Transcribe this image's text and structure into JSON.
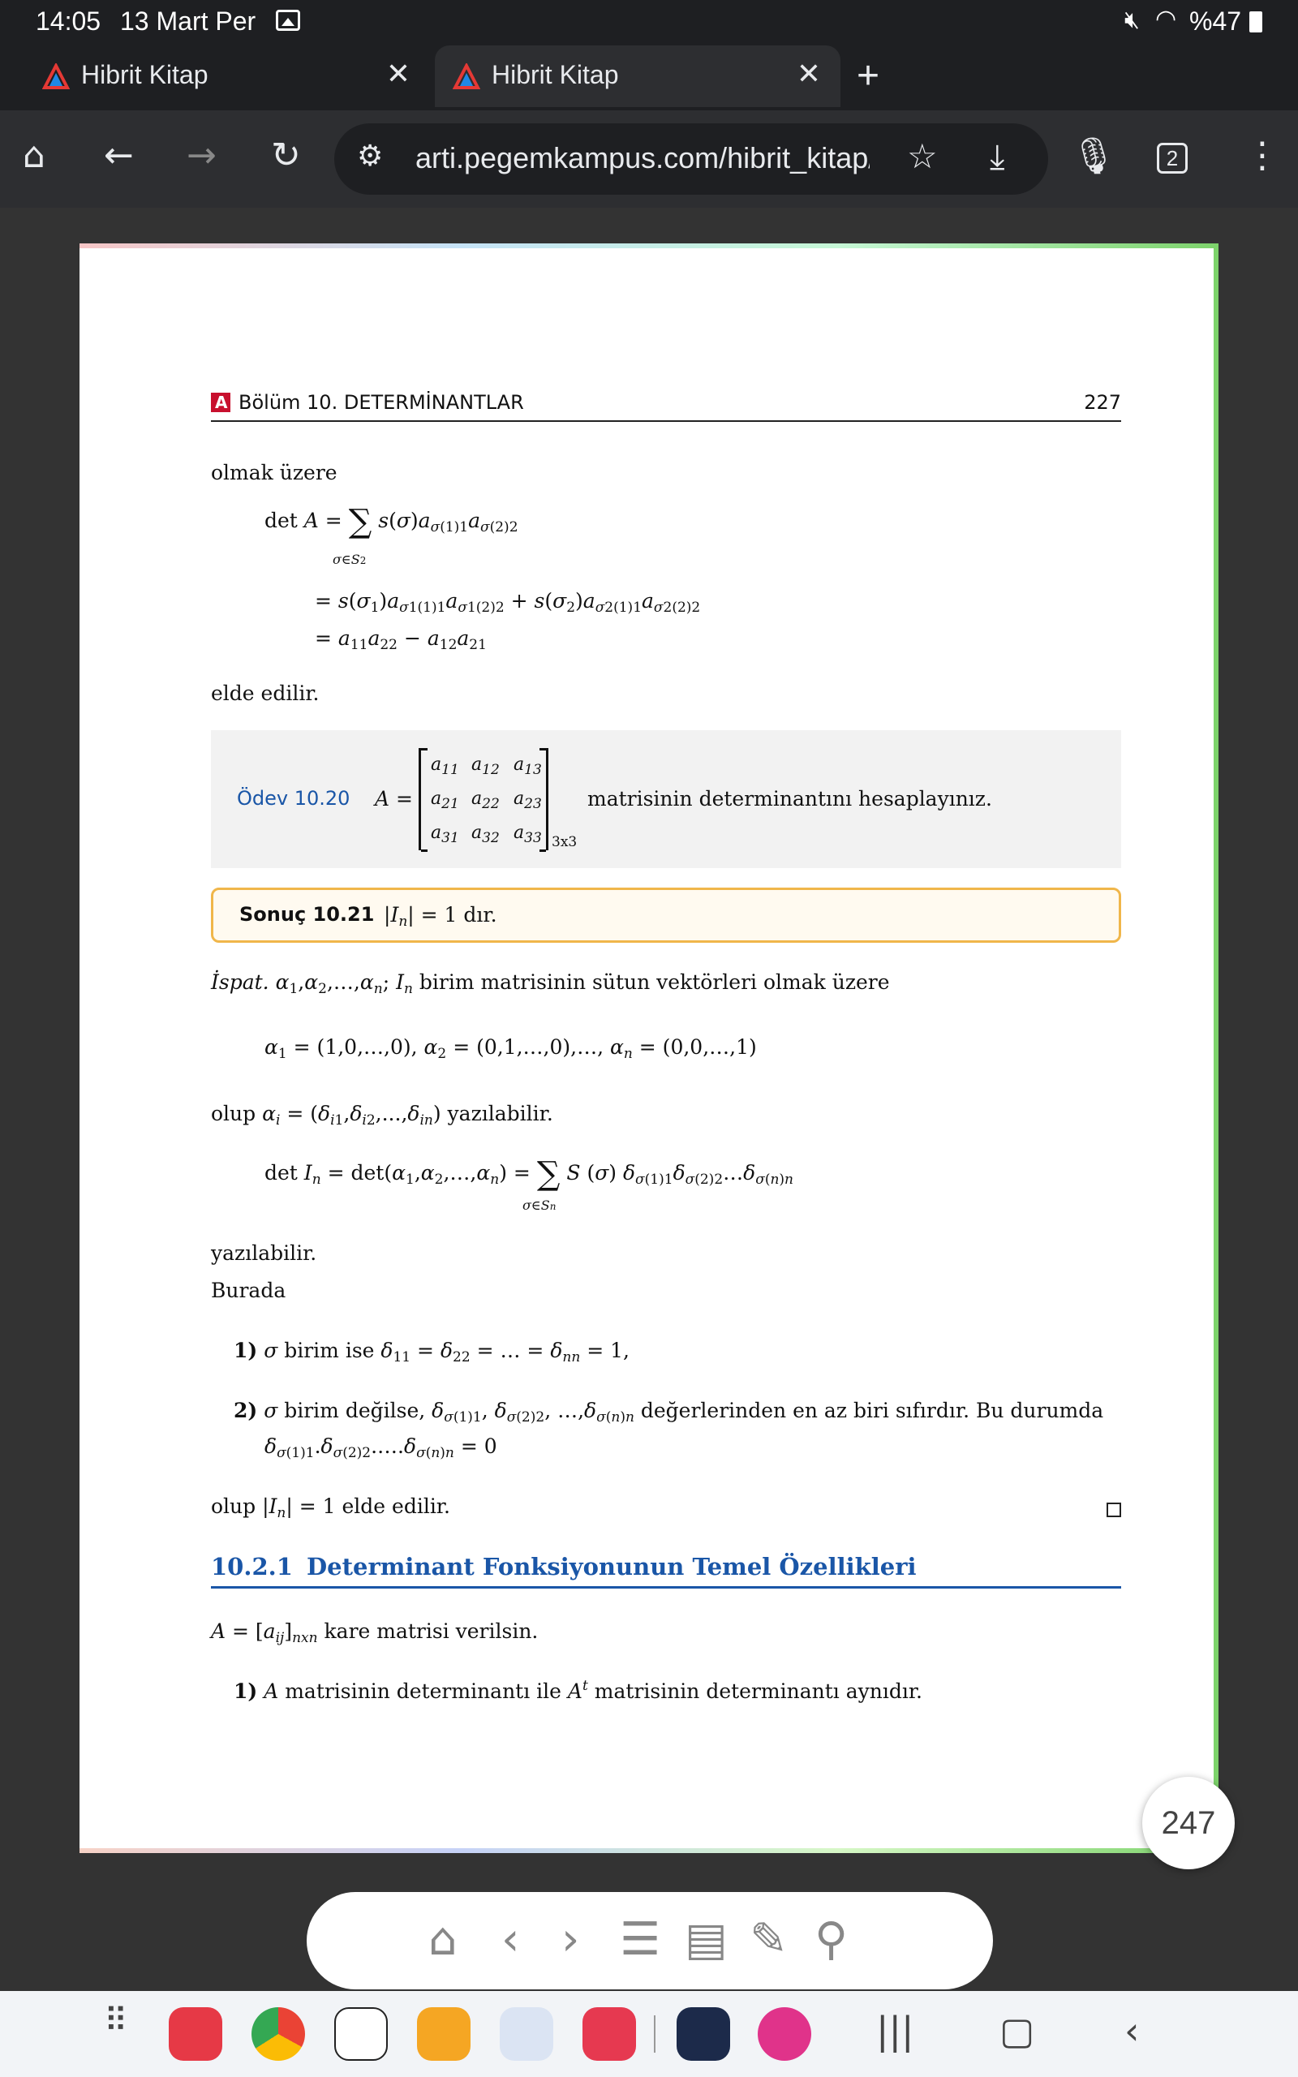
{
  "status": {
    "time": "14:05",
    "date": "13 Mart Per",
    "battery": "%47"
  },
  "tabs": [
    {
      "title": "Hibrit Kitap",
      "close": "✕"
    },
    {
      "title": "Hibrit Kitap",
      "close": "✕"
    }
  ],
  "new_tab": "+",
  "toolbar": {
    "url": "arti.pegemkampus.com/hibrit_kitap/",
    "tab_count": "2"
  },
  "page": {
    "chapter": "Bölüm 10.  DETERMİNANTLAR",
    "page_number": "227",
    "olmak_uzere": "olmak üzere",
    "elde_edilir": "elde edilir.",
    "odev_label": "Ödev  10.20",
    "odev_text": "matrisinin determinantını hesaplayınız.",
    "sonuc_label": "Sonuç  10.21",
    "sonuc_text": "| = 1 dır.",
    "ispat_label": "İspat.",
    "ispat_text": "birim matrisinin sütun vektörleri olmak üzere",
    "olup_line": "yazılabilir.",
    "yazilabilir": "yazılabilir.",
    "burada": "Burada",
    "item1_num": "1)",
    "item1_text": "birim ise",
    "item2_num": "2)",
    "item2_text": "birim değilse,",
    "item2_tail": "değerlerinden en az biri sıfırdır. Bu durumda",
    "olup_end": "| = 1 elde edilir.",
    "section_number": "10.2.1",
    "section_title": "Determinant Fonksiyonunun Temel Özellikleri",
    "kare_text": "kare matrisi verilsin.",
    "prop1_num": "1)",
    "prop1_text": "matrisinin determinantı ile",
    "prop1_tail": "matrisinin determinantı aynıdır."
  },
  "page_badge": "247",
  "colors": {
    "section_blue": "#1a56a7",
    "sonuc_border": "#f0b64a",
    "page_edge_green": "#7dd36b"
  }
}
